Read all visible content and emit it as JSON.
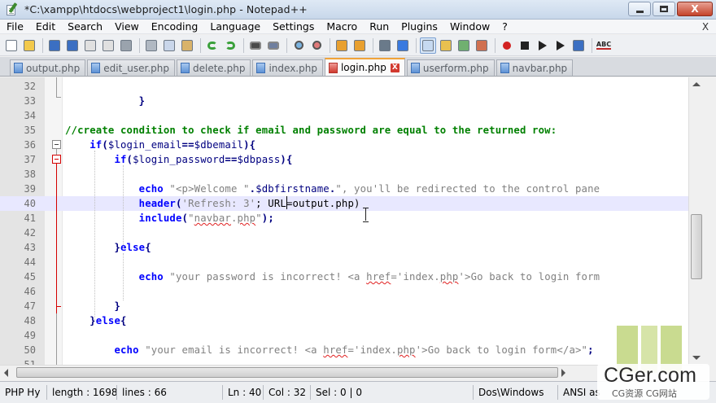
{
  "window": {
    "title": "*C:\\xampp\\htdocs\\webproject1\\login.php - Notepad++",
    "controls": {
      "minimize": "",
      "maximize": "",
      "close": "X"
    }
  },
  "menu": [
    "File",
    "Edit",
    "Search",
    "View",
    "Encoding",
    "Language",
    "Settings",
    "Macro",
    "Run",
    "Plugins",
    "Window",
    "?"
  ],
  "menu_close": "X",
  "toolbar": {
    "icons": [
      "new-file-icon",
      "open-file-icon",
      "save-icon",
      "save-all-icon",
      "close-icon",
      "close-all-icon",
      "print-icon",
      "cut-icon",
      "copy-icon",
      "paste-icon",
      "undo-icon",
      "redo-icon",
      "find-icon",
      "replace-icon",
      "zoom-in-icon",
      "zoom-out-icon",
      "sync-vertical-icon",
      "sync-horizontal-icon",
      "word-wrap-icon",
      "show-all-chars-icon",
      "indent-guide-icon",
      "user-lang-icon",
      "doc-map-icon",
      "function-list-icon",
      "record-macro-icon",
      "stop-macro-icon",
      "play-macro-icon",
      "run-macro-multiple-icon",
      "save-macro-icon",
      "spellcheck-icon"
    ],
    "spellcheck_label": "ABC"
  },
  "tabs": [
    {
      "label": "output.php",
      "active": false,
      "modified": false
    },
    {
      "label": "edit_user.php",
      "active": false,
      "modified": false
    },
    {
      "label": "delete.php",
      "active": false,
      "modified": false
    },
    {
      "label": "index.php",
      "active": false,
      "modified": false
    },
    {
      "label": "login.php",
      "active": true,
      "modified": true
    },
    {
      "label": "userform.php",
      "active": false,
      "modified": false
    },
    {
      "label": "navbar.php",
      "active": false,
      "modified": false
    }
  ],
  "tab_close_glyph": "X",
  "editor": {
    "lines": [
      {
        "n": "32",
        "segs": []
      },
      {
        "n": "33",
        "segs": [
          [
            "",
            "            "
          ],
          [
            "op",
            "}"
          ]
        ]
      },
      {
        "n": "34",
        "segs": []
      },
      {
        "n": "35",
        "segs": [
          [
            "cm",
            "//create condition to check if email and password are equal to the returned row:"
          ]
        ]
      },
      {
        "n": "36",
        "segs": [
          [
            "",
            "    "
          ],
          [
            "kw",
            "if"
          ],
          [
            "op",
            "("
          ],
          [
            "var",
            "$login_email"
          ],
          [
            "op",
            "=="
          ],
          [
            "var",
            "$dbemail"
          ],
          [
            "op",
            "){"
          ]
        ]
      },
      {
        "n": "37",
        "segs": [
          [
            "",
            "        "
          ],
          [
            "kw",
            "if"
          ],
          [
            "op",
            "("
          ],
          [
            "var",
            "$login_password"
          ],
          [
            "op",
            "=="
          ],
          [
            "var",
            "$dbpass"
          ],
          [
            "op",
            "){"
          ]
        ]
      },
      {
        "n": "38",
        "segs": []
      },
      {
        "n": "39",
        "segs": [
          [
            "",
            "            "
          ],
          [
            "kw",
            "echo"
          ],
          [
            "",
            " "
          ],
          [
            "str",
            "\"<p>Welcome \""
          ],
          [
            "op",
            "."
          ],
          [
            "var",
            "$dbfirstname"
          ],
          [
            "op",
            "."
          ],
          [
            "str",
            "\", you'll be redirected to the control pane"
          ]
        ]
      },
      {
        "n": "40",
        "segs": [
          [
            "",
            "            "
          ],
          [
            "kw",
            "header"
          ],
          [
            "op",
            "("
          ],
          [
            "str",
            "'Refresh: 3'"
          ],
          [
            "",
            "; URL=output.php)"
          ]
        ]
      },
      {
        "n": "41",
        "segs": [
          [
            "",
            "            "
          ],
          [
            "kw",
            "include"
          ],
          [
            "op",
            "("
          ],
          [
            "str",
            "\""
          ],
          [
            "str und",
            "navbar"
          ],
          [
            "str",
            "."
          ],
          [
            "str und",
            "php"
          ],
          [
            "str",
            "\""
          ],
          [
            "op",
            ");"
          ]
        ]
      },
      {
        "n": "42",
        "segs": []
      },
      {
        "n": "43",
        "segs": [
          [
            "",
            "        "
          ],
          [
            "op",
            "}"
          ],
          [
            "kw",
            "else"
          ],
          [
            "op",
            "{"
          ]
        ]
      },
      {
        "n": "44",
        "segs": []
      },
      {
        "n": "45",
        "segs": [
          [
            "",
            "            "
          ],
          [
            "kw",
            "echo"
          ],
          [
            "",
            " "
          ],
          [
            "str",
            "\"your password is incorrect! <a "
          ],
          [
            "str und",
            "href"
          ],
          [
            "str",
            "='index."
          ],
          [
            "str und",
            "php"
          ],
          [
            "str",
            "'>Go back to login form"
          ]
        ]
      },
      {
        "n": "46",
        "segs": []
      },
      {
        "n": "47",
        "segs": [
          [
            "",
            "        "
          ],
          [
            "op",
            "}"
          ]
        ]
      },
      {
        "n": "48",
        "segs": [
          [
            "",
            "    "
          ],
          [
            "op",
            "}"
          ],
          [
            "kw",
            "else"
          ],
          [
            "op",
            "{"
          ]
        ]
      },
      {
        "n": "49",
        "segs": []
      },
      {
        "n": "50",
        "segs": [
          [
            "",
            "        "
          ],
          [
            "kw",
            "echo"
          ],
          [
            "",
            " "
          ],
          [
            "str",
            "\"your email is incorrect! <a "
          ],
          [
            "str und",
            "href"
          ],
          [
            "str",
            "='index."
          ],
          [
            "str und",
            "php"
          ],
          [
            "str",
            "'>Go back to login form</a>\""
          ],
          [
            "op",
            ";"
          ]
        ]
      },
      {
        "n": "51",
        "segs": []
      }
    ],
    "current_line": "40"
  },
  "status": {
    "lang": "PHP Hy",
    "length": "length : 1698",
    "lines": "lines : 66",
    "ln": "Ln : 40",
    "col": "Col : 32",
    "sel": "Sel : 0 | 0",
    "eol": "Dos\\Windows",
    "encoding": "ANSI as"
  },
  "watermark": {
    "main": "CGer.com",
    "sub": "CG资源 CG网站"
  }
}
